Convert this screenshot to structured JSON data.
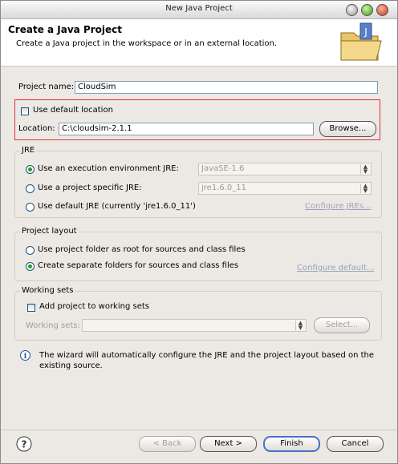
{
  "window": {
    "title": "New Java Project"
  },
  "header": {
    "title": "Create a Java Project",
    "description": "Create a Java project in the workspace or in an external location."
  },
  "project_name": {
    "label": "Project name:",
    "value": "CloudSim"
  },
  "location": {
    "use_default_label": "Use default location",
    "use_default_checked": false,
    "label": "Location:",
    "value": "C:\\cloudsim-2.1.1",
    "browse_label": "Browse..."
  },
  "jre": {
    "group_title": "JRE",
    "options": [
      {
        "label": "Use an execution environment JRE:",
        "selected": true,
        "combo": "JavaSE-1.6"
      },
      {
        "label": "Use a project specific JRE:",
        "selected": false,
        "combo": "jre1.6.0_11"
      },
      {
        "label": "Use default JRE (currently 'jre1.6.0_11')",
        "selected": false
      }
    ],
    "configure_link": "Configure JREs..."
  },
  "project_layout": {
    "group_title": "Project layout",
    "options": [
      {
        "label": "Use project folder as root for sources and class files",
        "selected": false
      },
      {
        "label": "Create separate folders for sources and class files",
        "selected": true
      }
    ],
    "configure_link": "Configure default..."
  },
  "working_sets": {
    "group_title": "Working sets",
    "add_label": "Add project to working sets",
    "add_checked": false,
    "field_label": "Working sets:",
    "field_value": "",
    "select_label": "Select..."
  },
  "info": {
    "icon": "info-icon",
    "text_line1": "The wizard will automatically configure the JRE and the project layout based on the",
    "text_line2": "existing source."
  },
  "footer": {
    "help_icon": "help-icon",
    "back_label": "< Back",
    "next_label": "Next >",
    "finish_label": "Finish",
    "cancel_label": "Cancel"
  },
  "colors": {
    "highlight_box": "#e0303a",
    "link_disabled": "#9aa3b8",
    "default_button_border": "#4d6ec9"
  }
}
